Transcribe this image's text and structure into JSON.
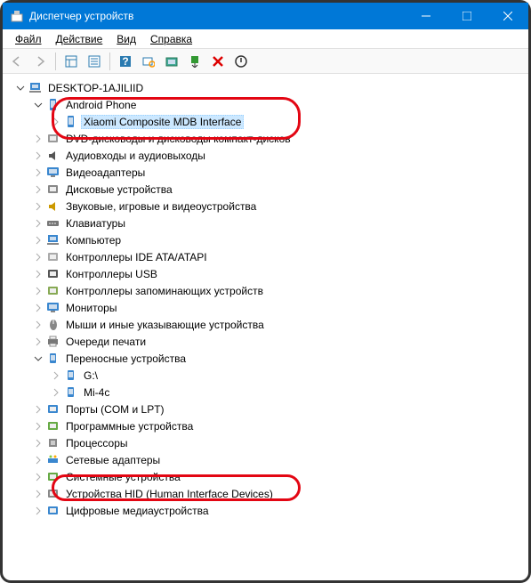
{
  "title": "Диспетчер устройств",
  "menu": {
    "file": "Файл",
    "action": "Действие",
    "view": "Вид",
    "help": "Справка"
  },
  "root": "DESKTOP-1AJILIID",
  "tree": [
    {
      "label": "Android Phone",
      "expanded": true,
      "icon": "phone",
      "level": 1,
      "children": [
        {
          "label": "Xiaomi Composite MDB Interface",
          "icon": "phone",
          "level": 2,
          "selected": true
        }
      ]
    },
    {
      "label": "DVD-дисководы и дисководы компакт-дисков",
      "icon": "dvd",
      "level": 1
    },
    {
      "label": "Аудиовходы и аудиовыходы",
      "icon": "audio",
      "level": 1
    },
    {
      "label": "Видеоадаптеры",
      "icon": "display",
      "level": 1
    },
    {
      "label": "Дисковые устройства",
      "icon": "disk",
      "level": 1
    },
    {
      "label": "Звуковые, игровые и видеоустройства",
      "icon": "sound",
      "level": 1
    },
    {
      "label": "Клавиатуры",
      "icon": "keyboard",
      "level": 1
    },
    {
      "label": "Компьютер",
      "icon": "computer",
      "level": 1
    },
    {
      "label": "Контроллеры IDE ATA/ATAPI",
      "icon": "ide",
      "level": 1
    },
    {
      "label": "Контроллеры USB",
      "icon": "usb",
      "level": 1
    },
    {
      "label": "Контроллеры запоминающих устройств",
      "icon": "storage",
      "level": 1
    },
    {
      "label": "Мониторы",
      "icon": "monitor",
      "level": 1
    },
    {
      "label": "Мыши и иные указывающие устройства",
      "icon": "mouse",
      "level": 1
    },
    {
      "label": "Очереди печати",
      "icon": "printer",
      "level": 1
    },
    {
      "label": "Переносные устройства",
      "expanded": true,
      "icon": "portable",
      "level": 1,
      "children": [
        {
          "label": "G:\\",
          "icon": "portable",
          "level": 2
        },
        {
          "label": "Mi-4c",
          "icon": "portable",
          "level": 2
        }
      ]
    },
    {
      "label": "Порты (COM и LPT)",
      "icon": "port",
      "level": 1
    },
    {
      "label": "Программные устройства",
      "icon": "software",
      "level": 1
    },
    {
      "label": "Процессоры",
      "icon": "cpu",
      "level": 1
    },
    {
      "label": "Сетевые адаптеры",
      "icon": "network",
      "level": 1
    },
    {
      "label": "Системные устройства",
      "icon": "system",
      "level": 1
    },
    {
      "label": "Устройства HID (Human Interface Devices)",
      "icon": "hid",
      "level": 1
    },
    {
      "label": "Цифровые медиаустройства",
      "icon": "media",
      "level": 1
    }
  ]
}
